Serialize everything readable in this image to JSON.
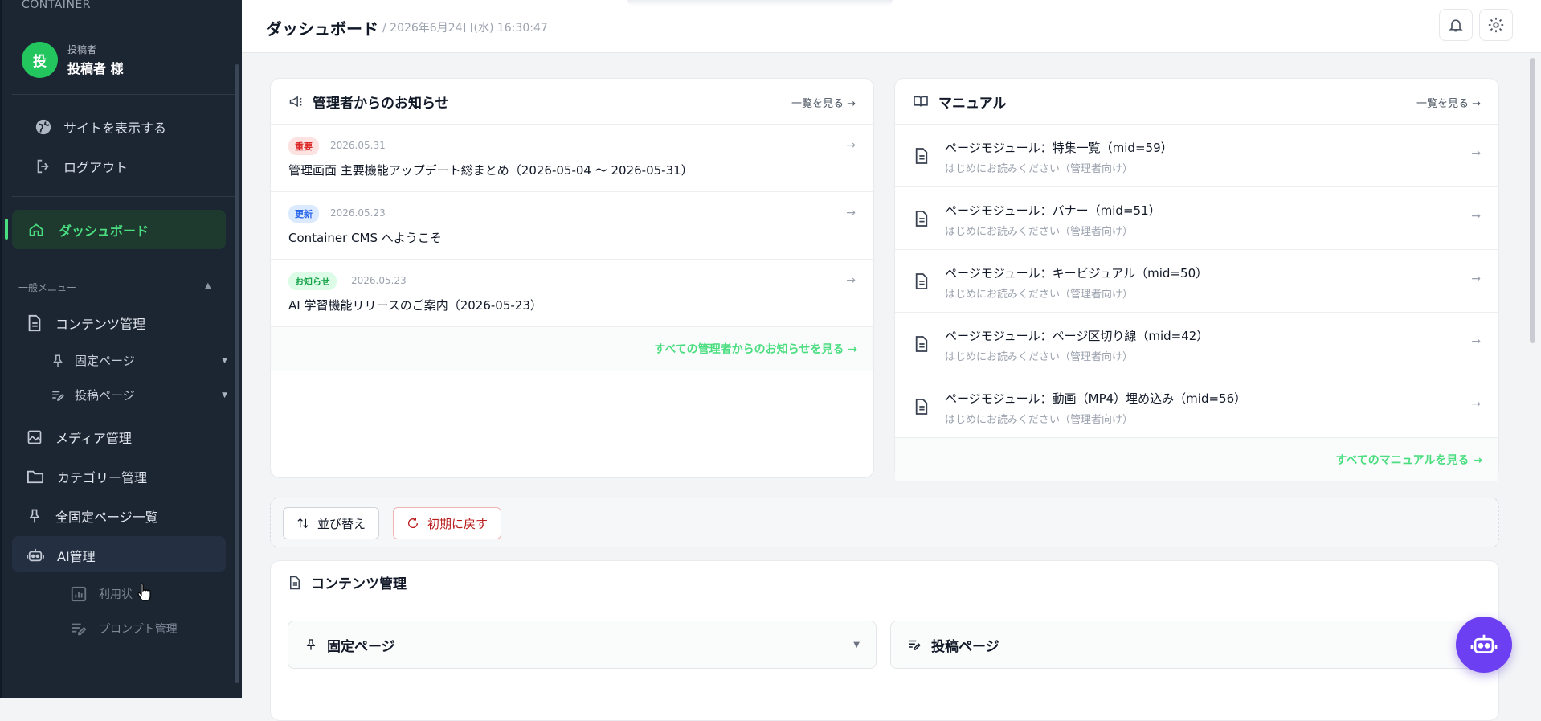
{
  "sidebar": {
    "brand": "CONTAINER",
    "user": {
      "avatar_initial": "投",
      "role": "投稿者",
      "name": "投稿者 様"
    },
    "view_site": "サイトを表示する",
    "logout": "ログアウト",
    "dashboard": "ダッシュボード",
    "section_label": "一般メニュー",
    "menu": {
      "contents": "コンテンツ管理",
      "fixed_page": "固定ページ",
      "post_page": "投稿ページ",
      "media": "メディア管理",
      "category": "カテゴリー管理",
      "all_fixed": "全固定ページ一覧",
      "ai": "AI管理",
      "usage": "利用状",
      "prompt": "プロンプト管理"
    },
    "accent": "#4ade80"
  },
  "header": {
    "title": "ダッシュボード",
    "datetime": "/ 2026年6月24日(水) 16:30:47",
    "icons": [
      "bell-icon",
      "gear-icon"
    ]
  },
  "news": {
    "title": "管理者からのお知らせ",
    "more": "一覧を見る →",
    "items": [
      {
        "badge": "重要",
        "date": "2026.05.31",
        "title": "管理画面 主要機能アップデート総まとめ（2026-05-04 〜 2026-05-31）",
        "arrow": "→"
      },
      {
        "badge": "更新",
        "date": "2026.05.23",
        "title": "Container CMS へようこそ",
        "arrow": "→"
      },
      {
        "badge": "お知らせ",
        "date": "2026.05.23",
        "title": "AI 学習機能リリースのご案内（2026-05-23）",
        "arrow": "→"
      }
    ],
    "footer": "すべての管理者からのお知らせを見る →"
  },
  "manual": {
    "title": "マニュアル",
    "more": "一覧を見る →",
    "items": [
      {
        "title": "ページモジュール：特集一覧（mid=59）",
        "sub": "はじめにお読みください（管理者向け）",
        "arrow": "→"
      },
      {
        "title": "ページモジュール：バナー（mid=51）",
        "sub": "はじめにお読みください（管理者向け）",
        "arrow": "→"
      },
      {
        "title": "ページモジュール：キービジュアル（mid=50）",
        "sub": "はじめにお読みください（管理者向け）",
        "arrow": "→"
      },
      {
        "title": "ページモジュール：ページ区切り線（mid=42）",
        "sub": "はじめにお読みください（管理者向け）",
        "arrow": "→"
      },
      {
        "title": "ページモジュール：動画（MP4）埋め込み（mid=56）",
        "sub": "はじめにお読みください（管理者向け）",
        "arrow": "→"
      }
    ],
    "footer": "すべてのマニュアルを見る →"
  },
  "toolbar": {
    "sort": "並び替え",
    "reset": "初期に戻す"
  },
  "contents": {
    "title": "コンテンツ管理",
    "fixed_page": "固定ページ",
    "post_page": "投稿ページ"
  }
}
